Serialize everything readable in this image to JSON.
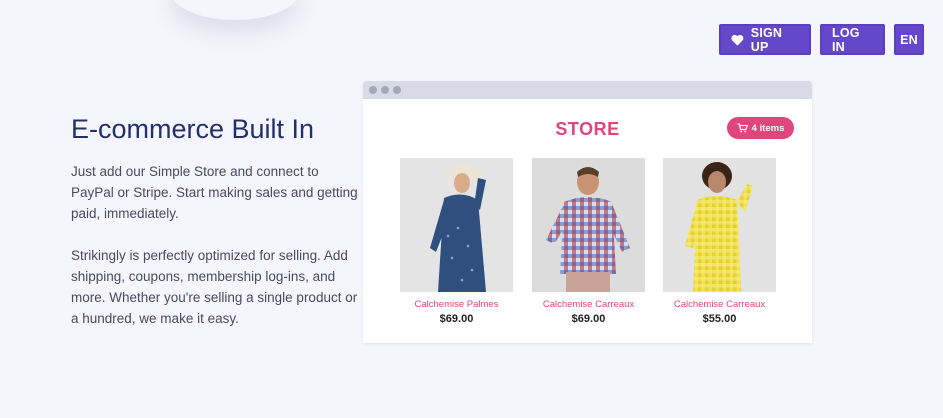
{
  "nav": {
    "signup_label": "SIGN UP",
    "login_label": "LOG IN",
    "lang_label": "EN"
  },
  "colors": {
    "background": "#f4f5fd",
    "nav_button": "#6448c9",
    "accent_pink": "#e0457b",
    "heading": "#23306a"
  },
  "section": {
    "heading": "E-commerce Built In",
    "paragraph1": "Just add our Simple Store and connect to PayPal or Stripe. Start making sales and getting paid, immediately.",
    "paragraph2": "Strikingly is perfectly optimized for selling. Add shipping, coupons, membership log-ins, and more. Whether you're selling a single product or a hundred, we make it easy."
  },
  "store": {
    "title": "STORE",
    "cart_label": "4 items",
    "products": [
      {
        "name": "Calchemise Palmes",
        "price": "$69.00",
        "shirt": "navy"
      },
      {
        "name": "Calchemise Carreaux",
        "price": "$69.00",
        "shirt": "red check"
      },
      {
        "name": "Calchemise Carreaux",
        "price": "$55.00",
        "shirt": "yellow check"
      }
    ]
  }
}
